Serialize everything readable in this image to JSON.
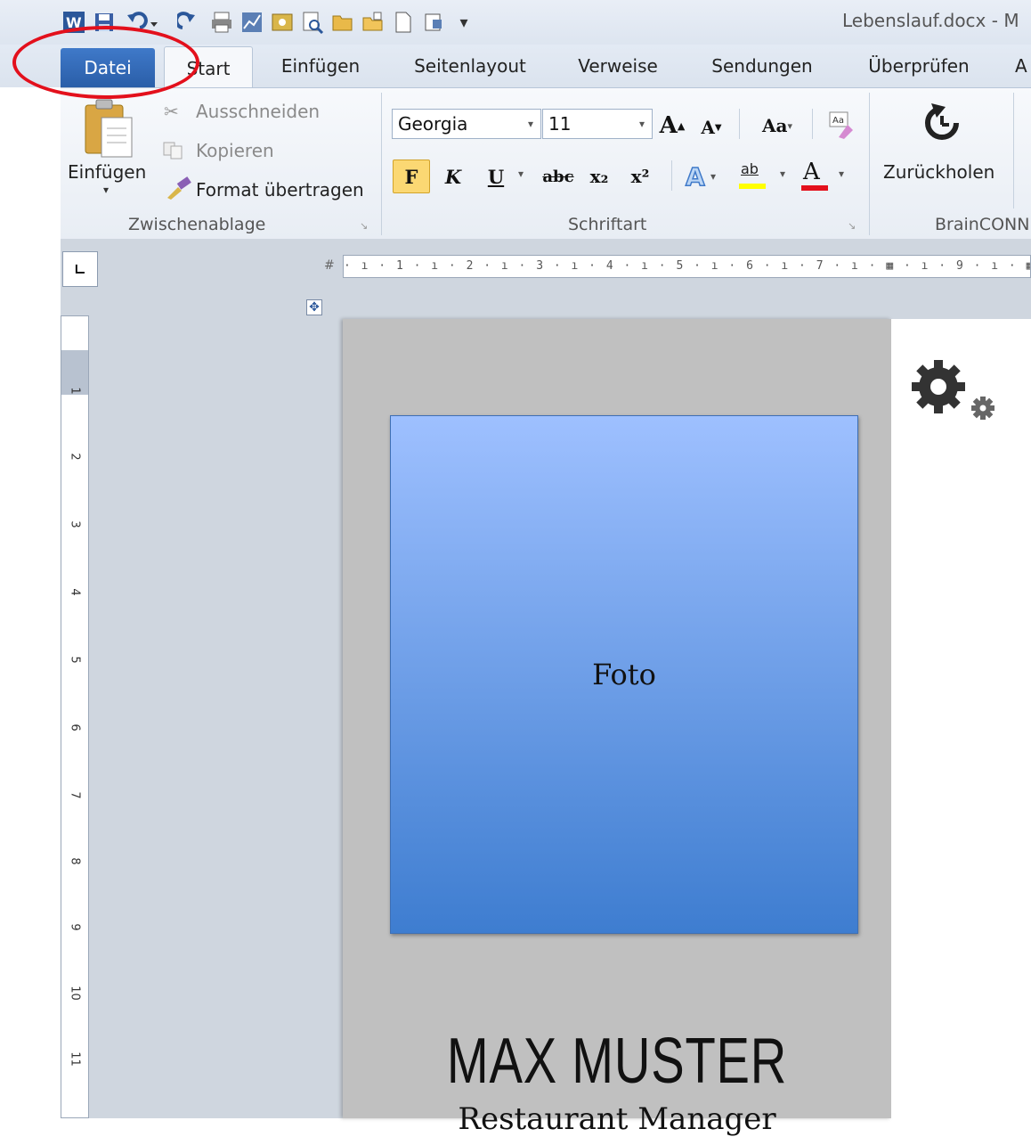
{
  "window": {
    "title": "Lebenslauf.docx - M"
  },
  "quick_access": [
    "word-icon",
    "save-icon",
    "undo-icon",
    "redo-icon",
    "print-icon",
    "chart-icon",
    "picture-icon",
    "print-preview-icon",
    "open-icon",
    "folder-icon",
    "new-doc-icon",
    "attach-icon"
  ],
  "tabs": {
    "file": "Datei",
    "items": [
      "Start",
      "Einfügen",
      "Seitenlayout",
      "Verweise",
      "Sendungen",
      "Überprüfen",
      "A"
    ]
  },
  "ribbon": {
    "clipboard": {
      "paste": "Einfügen",
      "cut": "Ausschneiden",
      "copy": "Kopieren",
      "format_painter": "Format übertragen",
      "group_label": "Zwischenablage"
    },
    "font": {
      "font_name": "Georgia",
      "font_size": "11",
      "grow": "A",
      "shrink": "A",
      "case": "Aa",
      "bold": "F",
      "italic": "K",
      "underline": "U",
      "strike": "abc",
      "subscript": "x₂",
      "superscript": "x²",
      "highlight": "ab",
      "font_color": "A",
      "group_label": "Schriftart"
    },
    "brainconnect": {
      "restore": "Zurückholen",
      "group_label": "BrainCONN"
    }
  },
  "ruler": {
    "h_numbers": [
      "1",
      "2",
      "3",
      "4",
      "5",
      "6",
      "7",
      "9"
    ],
    "v_numbers": [
      "1",
      "2",
      "3",
      "4",
      "5",
      "6",
      "7",
      "8",
      "9",
      "10",
      "11"
    ]
  },
  "document": {
    "photo_label": "Foto",
    "name": "MAX MUSTER",
    "subtitle": "Restaurant Manager"
  },
  "colors": {
    "annotation": "#e3101c",
    "file_tab": "#2a5ea8",
    "photo_top": "#9ec0ff",
    "photo_bottom": "#3e7dd0",
    "sidebar": "#c0c0c0"
  }
}
